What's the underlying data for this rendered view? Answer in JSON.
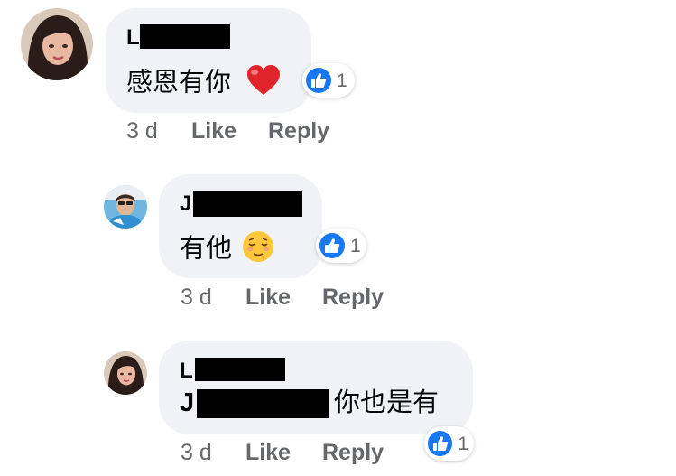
{
  "comments": [
    {
      "author_initial": "L",
      "text": "感恩有你",
      "emoji": "red-heart",
      "reaction_count": "1",
      "time": "3 d",
      "like_label": "Like",
      "reply_label": "Reply"
    },
    {
      "author_initial": "J",
      "text": "有他",
      "emoji": "relieved-face",
      "reaction_count": "1",
      "time": "3 d",
      "like_label": "Like",
      "reply_label": "Reply"
    },
    {
      "author_initial": "L",
      "mention_initial": "J",
      "text": "你也是有",
      "reaction_count": "1",
      "time": "3 d",
      "like_label": "Like",
      "reply_label": "Reply"
    }
  ],
  "colors": {
    "bubble": "#f0f2f5",
    "like_blue": "#1877f2",
    "meta_gray": "#65676b"
  }
}
